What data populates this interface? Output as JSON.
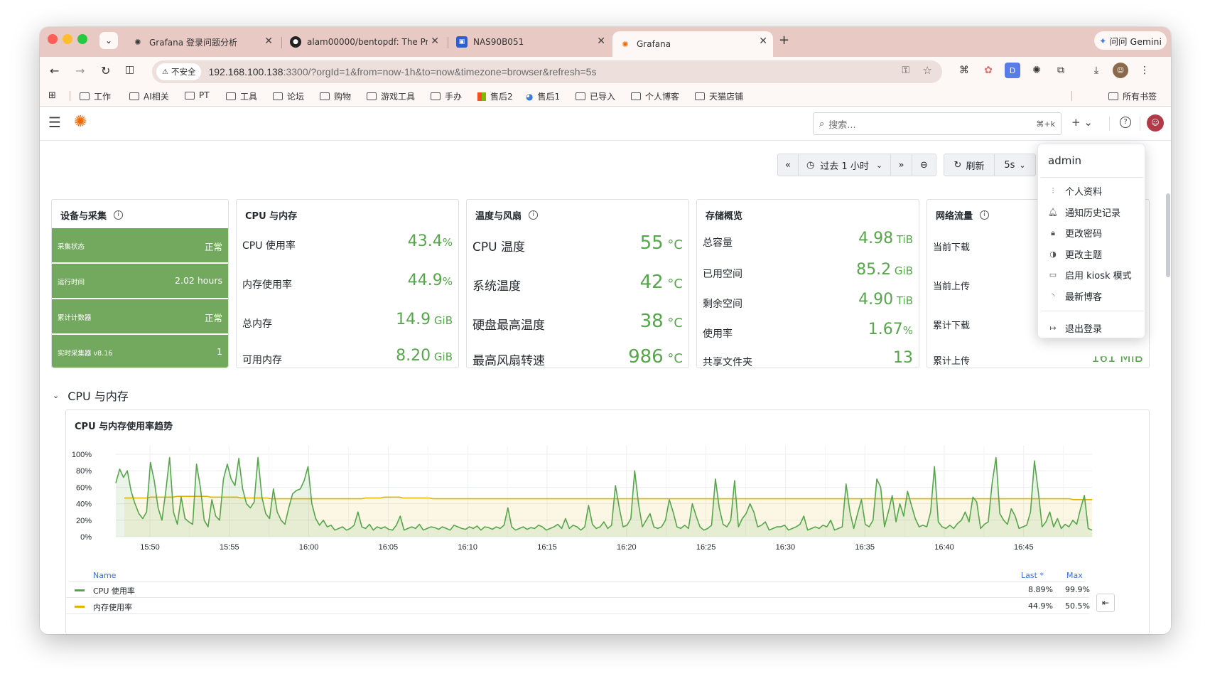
{
  "browser": {
    "tabs": [
      {
        "title": "Grafana 登录问题分析",
        "icon": "openai-icon"
      },
      {
        "title": "alam00000/bentopdf: The Pri",
        "icon": "github-icon"
      },
      {
        "title": "NAS90B051",
        "icon": "nas-icon"
      },
      {
        "title": "Grafana",
        "icon": "grafana-icon"
      }
    ],
    "gemini": "问问 Gemini",
    "insecure": "不安全",
    "url_host": "192.168.100.138",
    "url_rest": ":3300/?orgId=1&from=now-1h&to=now&timezone=browser&refresh=5s",
    "bookmarks": [
      "工作",
      "AI相关",
      "PT",
      "工具",
      "论坛",
      "购物",
      "游戏工具",
      "手办",
      "售后2",
      "售后1",
      "已导入",
      "个人博客",
      "天猫店铺"
    ],
    "all_bookmarks": "所有书签"
  },
  "grafana": {
    "search_placeholder": "搜索...",
    "search_shortcut": "⌘+k",
    "time_range": "过去 1 小时",
    "refresh_label": "刷新",
    "refresh_interval": "5s",
    "user_menu": {
      "user": "admin",
      "items": [
        "个人资料",
        "通知历史记录",
        "更改密码",
        "更改主题",
        "启用 kiosk 模式",
        "最新博客"
      ],
      "logout": "退出登录"
    },
    "panels": {
      "device": {
        "title": "设备与采集",
        "rows": [
          {
            "label": "采集状态",
            "value": "正常"
          },
          {
            "label": "运行时间",
            "value": "2.02 hours"
          },
          {
            "label": "累计计数器",
            "value": "正常"
          },
          {
            "label": "实时采集器 v8.16",
            "value": "1"
          }
        ]
      },
      "cpu": {
        "title": "CPU 与内存",
        "rows": [
          {
            "label": "CPU 使用率",
            "value": "43.4",
            "unit": "%"
          },
          {
            "label": "内存使用率",
            "value": "44.9",
            "unit": "%"
          },
          {
            "label": "总内存",
            "value": "14.9",
            "unit": " GiB"
          },
          {
            "label": "可用内存",
            "value": "8.20",
            "unit": " GiB"
          }
        ]
      },
      "temp": {
        "title": "温度与风扇",
        "rows": [
          {
            "label": "CPU 温度",
            "value": "55",
            "unit": " °C"
          },
          {
            "label": "系统温度",
            "value": "42",
            "unit": " °C"
          },
          {
            "label": "硬盘最高温度",
            "value": "38",
            "unit": " °C"
          },
          {
            "label": "最高风扇转速",
            "value": "986",
            "unit": " °C"
          }
        ]
      },
      "storage": {
        "title": "存储概览",
        "rows": [
          {
            "label": "总容量",
            "value": "4.98",
            "unit": " TiB"
          },
          {
            "label": "已用空间",
            "value": "85.2",
            "unit": " GiB"
          },
          {
            "label": "剩余空间",
            "value": "4.90",
            "unit": " TiB"
          },
          {
            "label": "使用率",
            "value": "1.67",
            "unit": "%"
          },
          {
            "label": "共享文件夹",
            "value": "13",
            "unit": ""
          }
        ]
      },
      "network": {
        "title": "网络流量",
        "rows": [
          {
            "label": "当前下载"
          },
          {
            "label": "当前上传"
          },
          {
            "label": "累计下载"
          },
          {
            "label": "累计上传",
            "value": "161 MiB"
          }
        ]
      }
    },
    "row_title": "CPU 与内存",
    "chart_title": "CPU 与内存使用率趋势",
    "legend_headers": {
      "name": "Name",
      "last": "Last *",
      "max": "Max"
    },
    "legend": [
      {
        "name": "CPU 使用率",
        "last": "8.89%",
        "max": "99.9%",
        "color": "#56a64b"
      },
      {
        "name": "内存使用率",
        "last": "44.9%",
        "max": "50.5%",
        "color": "#e0b400"
      }
    ]
  },
  "chart_data": {
    "type": "line",
    "title": "CPU 与内存使用率趋势",
    "x_ticks": [
      "15:50",
      "15:55",
      "16:00",
      "16:05",
      "16:10",
      "16:15",
      "16:20",
      "16:25",
      "16:30",
      "16:35",
      "16:40",
      "16:45"
    ],
    "y_ticks": [
      "0%",
      "20%",
      "40%",
      "60%",
      "80%",
      "100%"
    ],
    "ylim": [
      0,
      100
    ],
    "series": [
      {
        "name": "CPU 使用率",
        "color": "#56a64b",
        "values": [
          65,
          82,
          72,
          80,
          55,
          40,
          28,
          22,
          30,
          90,
          68,
          35,
          20,
          55,
          96,
          30,
          15,
          48,
          22,
          18,
          15,
          88,
          60,
          20,
          12,
          45,
          25,
          20,
          70,
          88,
          70,
          62,
          95,
          58,
          40,
          35,
          42,
          96,
          48,
          28,
          22,
          58,
          30,
          20,
          15,
          35,
          52,
          56,
          58,
          68,
          85,
          40,
          22,
          14,
          20,
          12,
          14,
          8,
          10,
          12,
          8,
          10,
          14,
          30,
          12,
          10,
          15,
          8,
          12,
          10,
          12,
          9,
          8,
          14,
          25,
          8,
          10,
          12,
          10,
          15,
          8,
          10,
          12,
          11,
          9,
          12,
          10,
          8,
          14,
          12,
          10,
          9,
          12,
          10,
          13,
          8,
          12,
          11,
          9,
          12,
          10,
          14,
          35,
          12,
          8,
          10,
          12,
          9,
          11,
          10,
          14,
          12,
          8,
          10,
          12,
          15,
          10,
          22,
          10,
          14,
          12,
          8,
          12,
          38,
          15,
          10,
          12,
          18,
          10,
          14,
          62,
          35,
          12,
          14,
          22,
          80,
          40,
          12,
          20,
          28,
          12,
          10,
          12,
          20,
          45,
          30,
          12,
          10,
          14,
          10,
          40,
          25,
          12,
          8,
          10,
          14,
          70,
          35,
          15,
          12,
          20,
          68,
          12,
          22,
          28,
          40,
          30,
          12,
          14,
          18,
          8,
          10,
          12,
          12,
          14,
          8,
          10,
          12,
          15,
          25,
          8,
          10,
          12,
          10,
          14,
          12,
          20,
          8,
          10,
          12,
          64,
          30,
          10,
          28,
          45,
          15,
          12,
          20,
          70,
          60,
          12,
          30,
          50,
          18,
          40,
          25,
          55,
          38,
          22,
          12,
          14,
          12,
          30,
          85,
          18,
          12,
          10,
          14,
          10,
          16,
          20,
          30,
          18,
          48,
          42,
          10,
          15,
          18,
          65,
          96,
          28,
          20,
          15,
          34,
          25,
          10,
          12,
          14,
          30,
          92,
          55,
          12,
          18,
          30,
          12,
          22,
          10,
          15,
          12,
          20,
          15,
          34,
          50,
          10,
          8
        ]
      },
      {
        "name": "内存使用率",
        "color": "#e0b400",
        "values": [
          47,
          47,
          47,
          47,
          47,
          47,
          47,
          48,
          48,
          48,
          48,
          48,
          48,
          48,
          49,
          49,
          49,
          49,
          49,
          49,
          49,
          49,
          49,
          48,
          48,
          48,
          48,
          48,
          48,
          48,
          48,
          47,
          47,
          47,
          47,
          47,
          47,
          47,
          47,
          46,
          46,
          46,
          46,
          46,
          46,
          46,
          46,
          46,
          46,
          46,
          46,
          46,
          46,
          46,
          46,
          46,
          46,
          46,
          46,
          46,
          46,
          46,
          46,
          46,
          47,
          47,
          47,
          47,
          47,
          48,
          48,
          48,
          48,
          48,
          47,
          47,
          47,
          47,
          47,
          47,
          47,
          47,
          46,
          46,
          46,
          46,
          46,
          46,
          46,
          46,
          46,
          46,
          46,
          46,
          46,
          46,
          46,
          46,
          46,
          46,
          46,
          46,
          46,
          46,
          46,
          46,
          46,
          46,
          46,
          46,
          46,
          46,
          46,
          46,
          46,
          46,
          46,
          46,
          46,
          46,
          46,
          46,
          46,
          46,
          46,
          46,
          46,
          46,
          46,
          46,
          46,
          46,
          46,
          46,
          46,
          46,
          46,
          46,
          46,
          46,
          46,
          46,
          46,
          46,
          46,
          46,
          46,
          46,
          46,
          46,
          46,
          46,
          46,
          46,
          46,
          46,
          46,
          46,
          46,
          46,
          46,
          46,
          46,
          46,
          46,
          46,
          46,
          46,
          46,
          46,
          46,
          46,
          46,
          46,
          46,
          46,
          46,
          46,
          46,
          46,
          46,
          46,
          46,
          46,
          46,
          46,
          46,
          46,
          46,
          46,
          46,
          46,
          46,
          46,
          46,
          46,
          46,
          46,
          46,
          46,
          46,
          46,
          46,
          46,
          46,
          46,
          46,
          46,
          46,
          46,
          46,
          46,
          46,
          46,
          46,
          46,
          46,
          46,
          46,
          46,
          46,
          46,
          46,
          46,
          46,
          46,
          46,
          46,
          46,
          46,
          46,
          46,
          46,
          46,
          46,
          46,
          46,
          46,
          46,
          46,
          46,
          46,
          46,
          46,
          46,
          46,
          46,
          46,
          46,
          46,
          46,
          46,
          45,
          45,
          45,
          45,
          45,
          45
        ]
      }
    ]
  }
}
